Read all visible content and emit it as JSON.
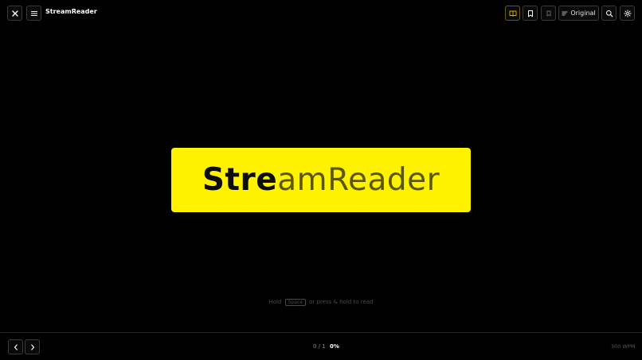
{
  "app": {
    "title": "StreamReader"
  },
  "toolbar": {
    "mode_label": "Original",
    "icons": [
      "close-icon",
      "menu-icon",
      "book-icon",
      "bookmark-icon",
      "bookmark-outline-icon",
      "lines-icon",
      "search-icon",
      "gear-icon"
    ]
  },
  "reader": {
    "word_focus": "Stre",
    "word_rest": "amReader"
  },
  "hint": {
    "prefix": "Hold",
    "key": "Space",
    "suffix": "or press & hold to read"
  },
  "footer": {
    "position": "0 / 1",
    "percent": "0%",
    "wpm": "300 WPM"
  },
  "colors": {
    "background": "#000000",
    "highlight": "#fff200",
    "active_icon": "#e0b100"
  }
}
